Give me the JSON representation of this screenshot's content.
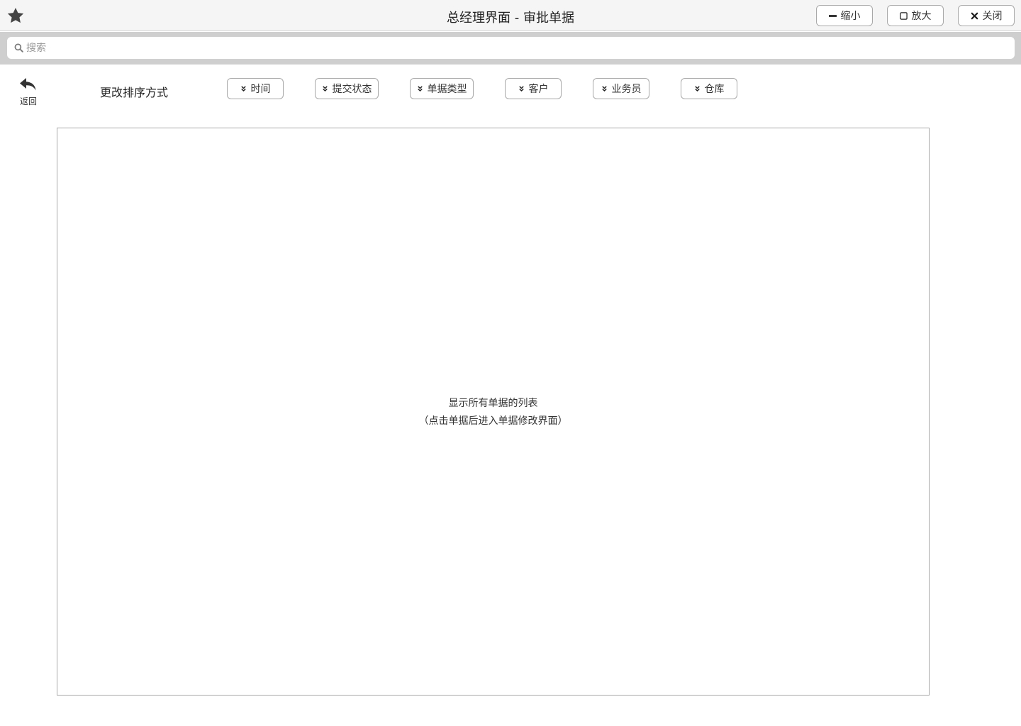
{
  "window": {
    "title": "总经理界面 - 审批单据",
    "buttons": {
      "minimize": "缩小",
      "maximize": "放大",
      "close": "关闭"
    },
    "star_icon": "star-icon"
  },
  "search": {
    "placeholder": "搜索",
    "value": ""
  },
  "toolbar": {
    "back_label": "返回",
    "sort_label": "更改排序方式",
    "sort_options": [
      "时间",
      "提交状态",
      "单据类型",
      "客户",
      "业务员",
      "仓库"
    ]
  },
  "panel": {
    "line1": "显示所有单据的列表",
    "line2": "（点击单据后进入单据修改界面）"
  },
  "colors": {
    "titlebar_bg": "#f5f5f5",
    "search_band_bg": "#cfcfcf",
    "border": "#a8a8a8",
    "icon": "#444444"
  }
}
